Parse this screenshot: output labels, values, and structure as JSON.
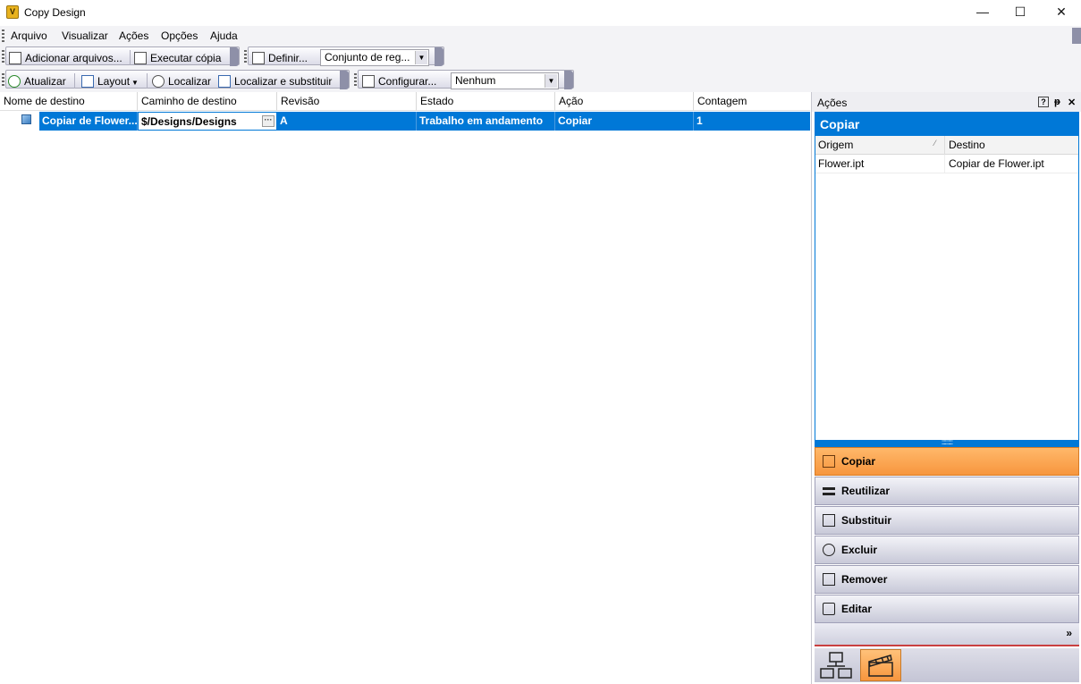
{
  "window": {
    "app_icon_letter": "V",
    "title": "Copy Design",
    "minimize_glyph": "—",
    "maximize_glyph": "☐",
    "close_glyph": "✕"
  },
  "menu": [
    "Arquivo",
    "Visualizar",
    "Ações",
    "Opções",
    "Ajuda"
  ],
  "toolbar1": {
    "add_files": "Adicionar arquivos...",
    "execute_copy": "Executar cópia",
    "define": "Definir...",
    "ruleset_value": "Conjunto de reg..."
  },
  "toolbar2": {
    "refresh": "Atualizar",
    "layout": "Layout",
    "find": "Localizar",
    "find_replace": "Localizar e substituir",
    "configure": "Configurar...",
    "filter_value": "Nenhum"
  },
  "grid": {
    "columns": [
      "Nome de destino",
      "Caminho de destino",
      "Revisão",
      "Estado",
      "Ação",
      "Contagem"
    ],
    "rows": [
      {
        "name": "Copiar de Flower...",
        "path": "$/Designs/Designs",
        "revision": "A",
        "state": "Trabalho em andamento",
        "action": "Copiar",
        "count": "1"
      }
    ]
  },
  "panel": {
    "title": "Ações",
    "help_glyph": "?",
    "pin_glyph": "ᵽ",
    "close_glyph": "✕",
    "section_title": "Copiar",
    "columns": [
      "Origem",
      "Destino"
    ],
    "rows": [
      {
        "origin": "Flower.ipt",
        "destination": "Copiar de Flower.ipt"
      }
    ],
    "actions": [
      "Copiar",
      "Reutilizar",
      "Substituir",
      "Excluir",
      "Remover",
      "Editar"
    ],
    "overflow_glyph": "»",
    "accent_color": "#0078d7",
    "active_color": "#f7963e"
  }
}
